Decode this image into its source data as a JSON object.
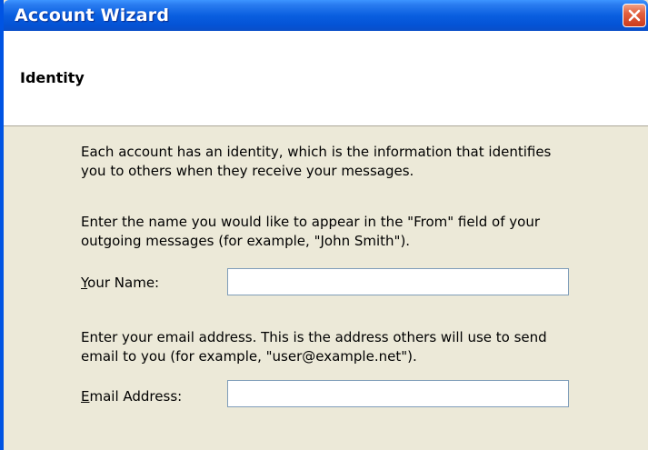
{
  "window": {
    "title": "Account Wizard",
    "close_icon": "close-icon"
  },
  "page": {
    "title": "Identity"
  },
  "content": {
    "intro_line1": "Each account has an identity, which is the information that identifies",
    "intro_line2": "you to others when they receive your messages.",
    "name_help_line1": "Enter the name you would like to appear in the \"From\" field of your",
    "name_help_line2": "outgoing messages (for example, \"John Smith\").",
    "name_label_accel": "Y",
    "name_label_rest": "our Name:",
    "name_value": "",
    "email_help_line1": "Enter your email address. This is the address others will use to send",
    "email_help_line2": "email to you (for example, \"user@example.net\").",
    "email_label_accel": "E",
    "email_label_rest": "mail Address:",
    "email_value": ""
  },
  "colors": {
    "titlebar": "#0a5fe0",
    "dialog_bg": "#ece9d8",
    "header_bg": "#ffffff",
    "close_button": "#e2603f",
    "input_border": "#7f9db9"
  }
}
